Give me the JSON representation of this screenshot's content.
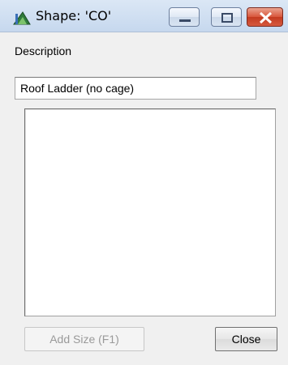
{
  "window": {
    "title": "Shape: 'CO'",
    "icon": "shape-app-icon",
    "controls": {
      "minimize": "minimize-icon",
      "maximize": "maximize-icon",
      "close": "close-icon"
    }
  },
  "form": {
    "description_label": "Description",
    "description_value": "Roof Ladder (no cage)",
    "sizes_list": []
  },
  "buttons": {
    "add_size": "Add Size (F1)",
    "close": "Close"
  },
  "colors": {
    "close_button": "#d8553a",
    "title_bar": "#c6d8ee"
  }
}
